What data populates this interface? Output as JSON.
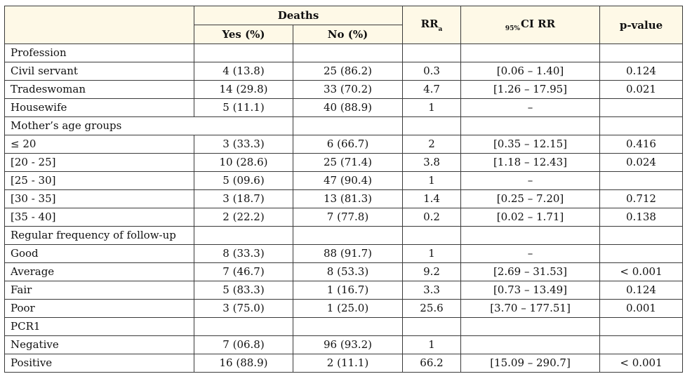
{
  "header": {
    "deaths": "Deaths",
    "yes": "Yes (%)",
    "no": "No (%)",
    "rr_main": "RR",
    "rr_sub": "a",
    "ci_prefix": "95%",
    "ci_main": "CI RR",
    "pvalue": "p-value"
  },
  "colors": {
    "header_bg": "#fef9e7",
    "border": "#3a3a3a",
    "text": "#111111"
  },
  "rows": [
    {
      "type": "section",
      "label": "Profession"
    },
    {
      "type": "data",
      "label": "Civil servant",
      "yes": "4 (13.8)",
      "no": "25 (86.2)",
      "rr": "0.3",
      "ci": "[0.06 – 1.40]",
      "p": "0.124"
    },
    {
      "type": "data",
      "label": "Tradeswoman",
      "yes": "14 (29.8)",
      "no": "33 (70.2)",
      "rr": "4.7",
      "ci": "[1.26 – 17.95]",
      "p": "0.021"
    },
    {
      "type": "data",
      "label": "Housewife",
      "yes": "5 (11.1)",
      "no": "40 (88.9)",
      "rr": "1",
      "ci": "–",
      "p": ""
    },
    {
      "type": "section-span",
      "label": "Mother’s age groups"
    },
    {
      "type": "data",
      "label": "≤ 20",
      "yes": "3 (33.3)",
      "no": "6 (66.7)",
      "rr": "2",
      "ci": "[0.35 – 12.15]",
      "p": "0.416"
    },
    {
      "type": "data",
      "label": "[20 - 25]",
      "yes": "10 (28.6)",
      "no": "25 (71.4)",
      "rr": "3.8",
      "ci": "[1.18 – 12.43]",
      "p": "0.024"
    },
    {
      "type": "data",
      "label": "[25 - 30]",
      "yes": "5 (09.6)",
      "no": "47 (90.4)",
      "rr": "1",
      "ci": "–",
      "p": ""
    },
    {
      "type": "data",
      "label": "[30 - 35]",
      "yes": "3 (18.7)",
      "no": "13 (81.3)",
      "rr": "1.4",
      "ci": "[0.25 – 7.20]",
      "p": "0.712"
    },
    {
      "type": "data",
      "label": "[35 - 40]",
      "yes": "2 (22.2)",
      "no": "7 (77.8)",
      "rr": "0.2",
      "ci": "[0.02 – 1.71]",
      "p": "0.138"
    },
    {
      "type": "section",
      "label": "Regular frequency of follow-up"
    },
    {
      "type": "data",
      "label": "Good",
      "yes": "8 (33.3)",
      "no": "88 (91.7)",
      "rr": "1",
      "ci": "–",
      "p": ""
    },
    {
      "type": "data",
      "label": "Average",
      "yes": "7 (46.7)",
      "no": "8 (53.3)",
      "rr": "9.2",
      "ci": "[2.69 – 31.53]",
      "p": "< 0.001"
    },
    {
      "type": "data",
      "label": "Fair",
      "yes": "5 (83.3)",
      "no": "1 (16.7)",
      "rr": "3.3",
      "ci": "[0.73 – 13.49]",
      "p": "0.124"
    },
    {
      "type": "data",
      "label": "Poor",
      "yes": "3 (75.0)",
      "no": "1 (25.0)",
      "rr": "25.6",
      "ci": "[3.70 – 177.51]",
      "p": "0.001"
    },
    {
      "type": "section",
      "label": "PCR1"
    },
    {
      "type": "data",
      "label": "Negative",
      "yes": "7 (06.8)",
      "no": "96 (93.2)",
      "rr": "1",
      "ci": "",
      "p": ""
    },
    {
      "type": "data",
      "label": "Positive",
      "yes": "16 (88.9)",
      "no": "2 (11.1)",
      "rr": "66.2",
      "ci": "[15.09 – 290.7]",
      "p": "< 0.001"
    }
  ]
}
